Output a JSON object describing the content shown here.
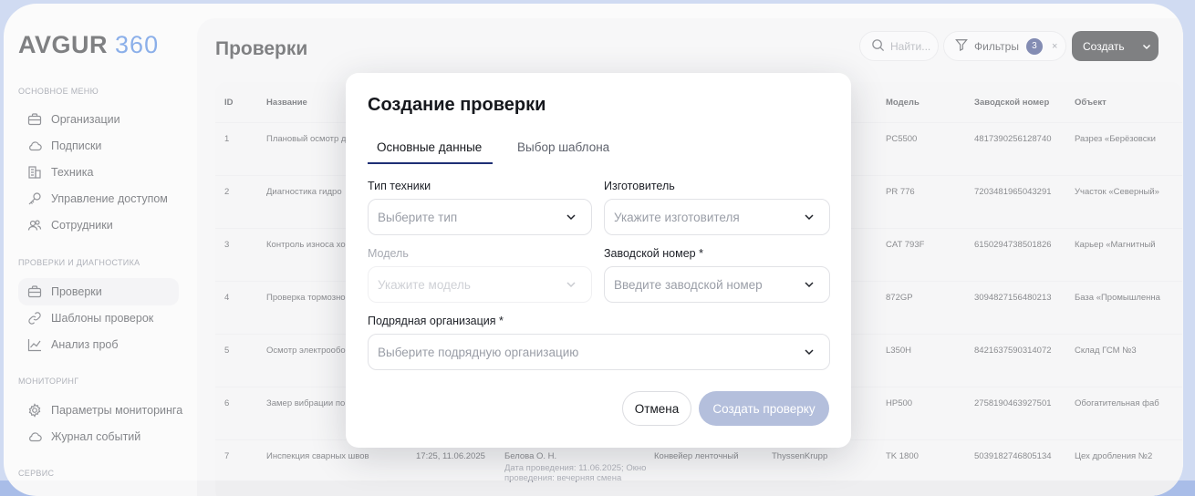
{
  "app": {
    "logo_text": "AVGUR",
    "logo_num": "360"
  },
  "sidebar": {
    "sections": [
      {
        "title": "ОСНОВНОЕ МЕНЮ"
      },
      {
        "title": "ПРОВЕРКИ И ДИАГНОСТИКА"
      },
      {
        "title": "МОНИТОРИНГ"
      },
      {
        "title": "СЕРВИС"
      }
    ],
    "items": [
      {
        "label": "Организации",
        "icon": "briefcase-icon"
      },
      {
        "label": "Подписки",
        "icon": "cloud-icon"
      },
      {
        "label": "Техника",
        "icon": "building-icon"
      },
      {
        "label": "Управление доступом",
        "icon": "key-icon"
      },
      {
        "label": "Сотрудники",
        "icon": "users-icon"
      },
      {
        "label": "Проверки",
        "icon": "briefcase-icon"
      },
      {
        "label": "Шаблоны проверок",
        "icon": "link-icon"
      },
      {
        "label": "Анализ проб",
        "icon": "chart-icon"
      },
      {
        "label": "Параметры мониторинга",
        "icon": "gear-icon"
      },
      {
        "label": "Журнал событий",
        "icon": "cloud-icon"
      }
    ]
  },
  "header": {
    "title": "Проверки",
    "search_placeholder": "Найти...",
    "filters_label": "Фильтры",
    "filters_count": "3",
    "filters_clear": "×",
    "create_label": "Создать"
  },
  "table": {
    "columns": {
      "id": "ID",
      "name": "Название",
      "model": "Модель",
      "serial": "Заводской номер",
      "object": "Объект"
    },
    "rows": [
      {
        "id": "1",
        "name": "Плановый осмотр д",
        "model": "PC5500",
        "serial": "4817390256128740",
        "object": "Разрез «Берёзовски"
      },
      {
        "id": "2",
        "name": "Диагностика гидро",
        "model": "PR 776",
        "serial": "7203481965043291",
        "object": "Участок «Северный»"
      },
      {
        "id": "3",
        "name": "Контроль износа хо",
        "model": "CAT 793F",
        "serial": "6150294738501826",
        "object": "Карьер «Магнитный"
      },
      {
        "id": "4",
        "name": "Проверка тормозно",
        "model": "872GP",
        "serial": "3094827156480213",
        "object": "База «Промышленна"
      },
      {
        "id": "5",
        "name": "Осмотр электрообо",
        "model": "L350H",
        "serial": "8421637590314072",
        "object": "Склад ГСМ №3"
      },
      {
        "id": "6",
        "name": "Замер вибрации по",
        "model": "HP500",
        "serial": "2758190463927501",
        "object": "Обогатительная фаб"
      },
      {
        "id": "7",
        "name": "Инспекция сварных швов",
        "time": "17:25, 11.06.2025",
        "person": "Белова О. Н.",
        "sub": "Дата проведения: 11.06.2025; Окно проведения: вечерняя смена",
        "equipment": "Конвейер ленточный",
        "maker": "ThyssenKrupp",
        "model": "TK 1800",
        "serial": "5039182746805134",
        "object": "Цех дробления №2"
      }
    ]
  },
  "modal": {
    "title": "Создание проверки",
    "tabs": [
      "Основные данные",
      "Выбор шаблона"
    ],
    "fields": {
      "type": {
        "label": "Тип техники",
        "placeholder": "Выберите тип"
      },
      "maker": {
        "label": "Изготовитель",
        "placeholder": "Укажите изготовителя"
      },
      "model": {
        "label": "Модель",
        "placeholder": "Укажите модель"
      },
      "serial": {
        "label": "Заводской номер *",
        "placeholder": "Введите заводской номер"
      },
      "contractor": {
        "label": "Подрядная организация *",
        "placeholder": "Выберите подрядную организацию"
      }
    },
    "cancel_label": "Отмена",
    "submit_label": "Создать проверку"
  },
  "colors": {
    "accent": "#1e2f75",
    "logo_num": "#2d6ed8",
    "submit_disabled": "#b4bfdc",
    "frame": "#a9bde8"
  }
}
